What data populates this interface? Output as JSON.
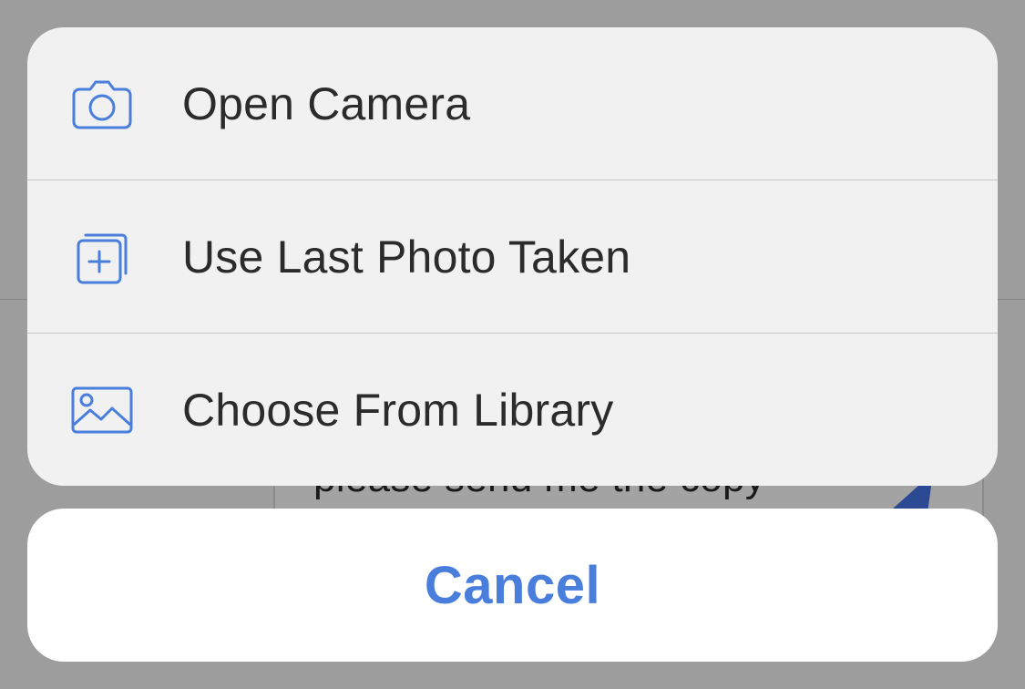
{
  "background": {
    "partial_text": "please send me the copy"
  },
  "action_sheet": {
    "items": [
      {
        "label": "Open Camera",
        "icon": "camera-icon"
      },
      {
        "label": "Use Last Photo Taken",
        "icon": "add-photo-stack-icon"
      },
      {
        "label": "Choose From Library",
        "icon": "image-icon"
      }
    ],
    "cancel_label": "Cancel"
  },
  "colors": {
    "accent": "#4a7edc",
    "sheet_background": "#f1f1f1",
    "overlay": "#9b9b9b",
    "label_text": "#2b2b2c"
  }
}
